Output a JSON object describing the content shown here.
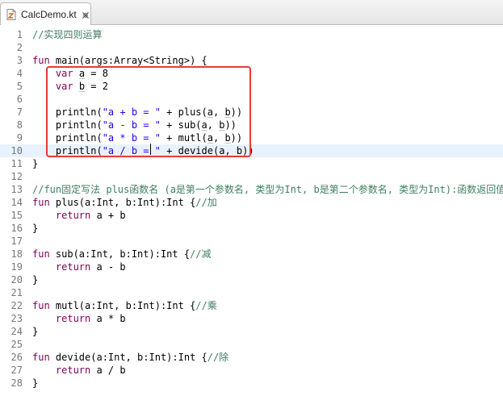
{
  "tab": {
    "title": "CalcDemo.kt"
  },
  "colors": {
    "comment": "#3f7f5f",
    "keyword": "#7f0055",
    "string": "#2a00ff",
    "line_number": "#787878",
    "current_line": "#e8f2fe",
    "highlight_border": "#e53b3b"
  },
  "icons": {
    "file": "kotlin-file-icon",
    "close": "close-icon"
  },
  "editor": {
    "current_line": 10,
    "lines": [
      {
        "n": "1",
        "tokens": [
          {
            "t": "//实现四则运算",
            "c": "comment"
          }
        ]
      },
      {
        "n": "2",
        "tokens": []
      },
      {
        "n": "3",
        "tokens": [
          {
            "t": "fun ",
            "c": "kw"
          },
          {
            "t": "main(args:Array<String>) {",
            "c": "plain"
          }
        ]
      },
      {
        "n": "4",
        "tokens": [
          {
            "t": "    ",
            "c": "plain"
          },
          {
            "t": "var ",
            "c": "kw"
          },
          {
            "t": "a",
            "c": "param"
          },
          {
            "t": " = 8",
            "c": "plain"
          }
        ]
      },
      {
        "n": "5",
        "tokens": [
          {
            "t": "    ",
            "c": "plain"
          },
          {
            "t": "var ",
            "c": "kw"
          },
          {
            "t": "b",
            "c": "param"
          },
          {
            "t": " = 2",
            "c": "plain"
          }
        ]
      },
      {
        "n": "6",
        "tokens": []
      },
      {
        "n": "7",
        "tokens": [
          {
            "t": "    println(",
            "c": "plain"
          },
          {
            "t": "\"a + b = \"",
            "c": "str"
          },
          {
            "t": " + plus(",
            "c": "plain"
          },
          {
            "t": "a",
            "c": "param"
          },
          {
            "t": ", ",
            "c": "plain"
          },
          {
            "t": "b",
            "c": "param"
          },
          {
            "t": "))",
            "c": "plain"
          }
        ]
      },
      {
        "n": "8",
        "tokens": [
          {
            "t": "    println(",
            "c": "plain"
          },
          {
            "t": "\"a - b = \"",
            "c": "str"
          },
          {
            "t": " + sub(",
            "c": "plain"
          },
          {
            "t": "a",
            "c": "param"
          },
          {
            "t": ", ",
            "c": "plain"
          },
          {
            "t": "b",
            "c": "param"
          },
          {
            "t": "))",
            "c": "plain"
          }
        ]
      },
      {
        "n": "9",
        "tokens": [
          {
            "t": "    println(",
            "c": "plain"
          },
          {
            "t": "\"a * b = \"",
            "c": "str"
          },
          {
            "t": " + mutl(",
            "c": "plain"
          },
          {
            "t": "a",
            "c": "param"
          },
          {
            "t": ", ",
            "c": "plain"
          },
          {
            "t": "b",
            "c": "param"
          },
          {
            "t": "))",
            "c": "plain"
          }
        ]
      },
      {
        "n": "10",
        "tokens": [
          {
            "t": "    println(",
            "c": "plain"
          },
          {
            "t": "\"a / b = \"",
            "c": "str"
          },
          {
            "t": " + devide(",
            "c": "plain"
          },
          {
            "t": "a",
            "c": "param"
          },
          {
            "t": ", ",
            "c": "plain"
          },
          {
            "t": "b",
            "c": "param"
          },
          {
            "t": "))",
            "c": "plain"
          }
        ]
      },
      {
        "n": "11",
        "tokens": [
          {
            "t": "}",
            "c": "plain"
          }
        ]
      },
      {
        "n": "12",
        "tokens": []
      },
      {
        "n": "13",
        "tokens": [
          {
            "t": "//fun固定写法 plus函数名 (a是第一个参数名, 类型为Int, b是第二个参数名, 类型为Int):函数返回值是Int",
            "c": "comment"
          }
        ]
      },
      {
        "n": "14",
        "tokens": [
          {
            "t": "fun ",
            "c": "kw"
          },
          {
            "t": "plus(a:Int, b:Int):Int {",
            "c": "plain"
          },
          {
            "t": "//加",
            "c": "comment"
          }
        ]
      },
      {
        "n": "15",
        "tokens": [
          {
            "t": "    ",
            "c": "plain"
          },
          {
            "t": "return ",
            "c": "kw"
          },
          {
            "t": "a + b",
            "c": "plain"
          }
        ]
      },
      {
        "n": "16",
        "tokens": [
          {
            "t": "}",
            "c": "plain"
          }
        ]
      },
      {
        "n": "17",
        "tokens": []
      },
      {
        "n": "18",
        "tokens": [
          {
            "t": "fun ",
            "c": "kw"
          },
          {
            "t": "sub(a:Int, b:Int):Int {",
            "c": "plain"
          },
          {
            "t": "//减",
            "c": "comment"
          }
        ]
      },
      {
        "n": "19",
        "tokens": [
          {
            "t": "    ",
            "c": "plain"
          },
          {
            "t": "return ",
            "c": "kw"
          },
          {
            "t": "a - b",
            "c": "plain"
          }
        ]
      },
      {
        "n": "20",
        "tokens": [
          {
            "t": "}",
            "c": "plain"
          }
        ]
      },
      {
        "n": "21",
        "tokens": []
      },
      {
        "n": "22",
        "tokens": [
          {
            "t": "fun ",
            "c": "kw"
          },
          {
            "t": "mutl(a:Int, b:Int):Int {",
            "c": "plain"
          },
          {
            "t": "//乘",
            "c": "comment"
          }
        ]
      },
      {
        "n": "23",
        "tokens": [
          {
            "t": "    ",
            "c": "plain"
          },
          {
            "t": "return ",
            "c": "kw"
          },
          {
            "t": "a * b",
            "c": "plain"
          }
        ]
      },
      {
        "n": "24",
        "tokens": [
          {
            "t": "}",
            "c": "plain"
          }
        ]
      },
      {
        "n": "25",
        "tokens": []
      },
      {
        "n": "26",
        "tokens": [
          {
            "t": "fun ",
            "c": "kw"
          },
          {
            "t": "devide(a:Int, b:Int):Int {",
            "c": "plain"
          },
          {
            "t": "//除",
            "c": "comment"
          }
        ]
      },
      {
        "n": "27",
        "tokens": [
          {
            "t": "    ",
            "c": "plain"
          },
          {
            "t": "return ",
            "c": "kw"
          },
          {
            "t": "a / b",
            "c": "plain"
          }
        ]
      },
      {
        "n": "28",
        "tokens": [
          {
            "t": "}",
            "c": "plain"
          }
        ]
      }
    ]
  }
}
